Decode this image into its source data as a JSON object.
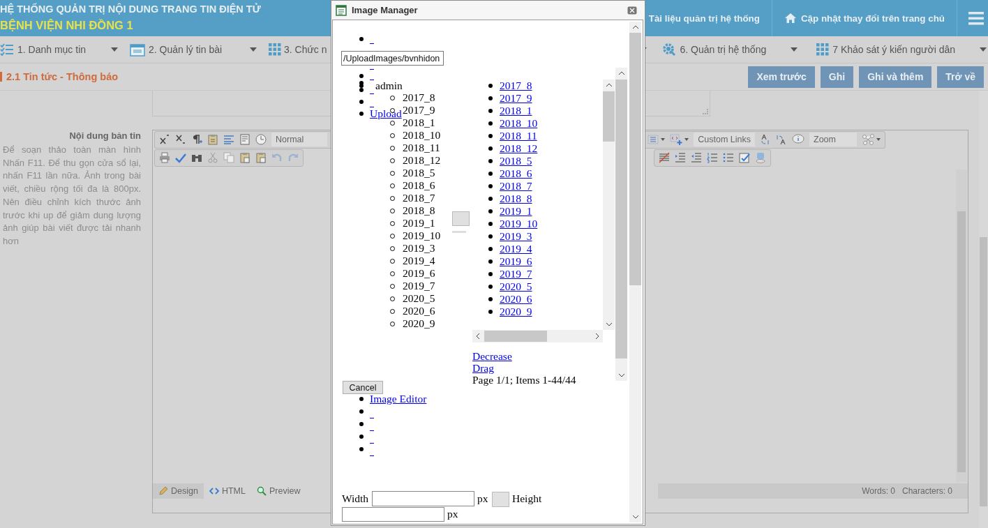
{
  "header": {
    "title": "HỆ THỐNG QUẢN TRỊ NỘI DUNG TRANG TIN ĐIỆN TỬ",
    "subtitle": "BỆNH VIỆN NHI ĐỒNG 1",
    "links": [
      {
        "label": "Tài liệu quản trị hệ thống",
        "kind": "plain"
      },
      {
        "label": "Cập nhật thay đổi trên trang chủ",
        "kind": "home"
      }
    ]
  },
  "menu": {
    "left": [
      {
        "label": "1. Danh mục tin",
        "kind": "list"
      },
      {
        "label": "2. Quản lý tin bài",
        "kind": "calendar"
      },
      {
        "label": "3. Chức n",
        "kind": "grid"
      }
    ],
    "right": [
      {
        "label": "6. Quản trị hệ thống",
        "kind": "gear"
      },
      {
        "label": "7 Khảo sát ý kiến người dân",
        "kind": "grid"
      }
    ]
  },
  "page_title": "2.1 Tin tức - Thông báo",
  "actions": [
    "Xem trước",
    "Ghi",
    "Ghi và thêm",
    "Trở về"
  ],
  "content_label": "Nội dung bản tin",
  "help_text": "Để soạn thảo toàn màn hình Nhấn F11. Để thu gọn cửa sổ lại, nhấn F11 lần nữa. Ảnh trong bài viết, chiều rộng tối đa là 800px. Nên điều chỉnh kích thước ảnh trước khi up để giảm dung lượng ảnh giúp bài viết được tải nhanh hơn",
  "editor": {
    "format": "Normal",
    "custom_links": "Custom Links",
    "zoom": "Zoom",
    "tabs": [
      {
        "label": "Design",
        "kind": "design",
        "selected": true
      },
      {
        "label": "HTML",
        "kind": "html",
        "selected": false
      },
      {
        "label": "Preview",
        "kind": "preview",
        "selected": false
      }
    ],
    "words": "Words: 0",
    "characters": "Characters: 0"
  },
  "dialog": {
    "title": "Image Manager",
    "path": "/UploadImages/bvnhidon",
    "tree": {
      "label": "admin",
      "children": [
        {
          "label": "2017_8"
        },
        {
          "label": "2017_9"
        },
        {
          "label": "2018_1"
        },
        {
          "label": "2018_10"
        },
        {
          "label": "2018_11"
        },
        {
          "label": "2018_12"
        },
        {
          "label": "2018_5"
        },
        {
          "label": "2018_6"
        },
        {
          "label": "2018_7"
        },
        {
          "label": "2018_8"
        },
        {
          "label": "2019_1"
        },
        {
          "label": "2019_10"
        },
        {
          "label": "2019_3"
        },
        {
          "label": "2019_4"
        },
        {
          "label": "2019_6"
        },
        {
          "label": "2019_7"
        },
        {
          "label": "2020_5"
        },
        {
          "label": "2020_6"
        },
        {
          "label": "2020_9"
        }
      ]
    },
    "upload": "Upload",
    "files": [
      "2017_8",
      "2017_9",
      "2018_1",
      "2018_10",
      "2018_11",
      "2018_12",
      "2018_5",
      "2018_6",
      "2018_7",
      "2018_8",
      "2019_1",
      "2019_10",
      "2019_3",
      "2019_4",
      "2019_6",
      "2019_7",
      "2020_5",
      "2020_6",
      "2020_9"
    ],
    "decrease": "Decrease",
    "drag": "Drag",
    "pager": "Page 1/1; Items 1-44/44",
    "cancel": "Cancel",
    "image_editor": "Image Editor",
    "width_label": "Width",
    "width_unit": "px",
    "height_label": "Height",
    "height_unit": "px"
  }
}
